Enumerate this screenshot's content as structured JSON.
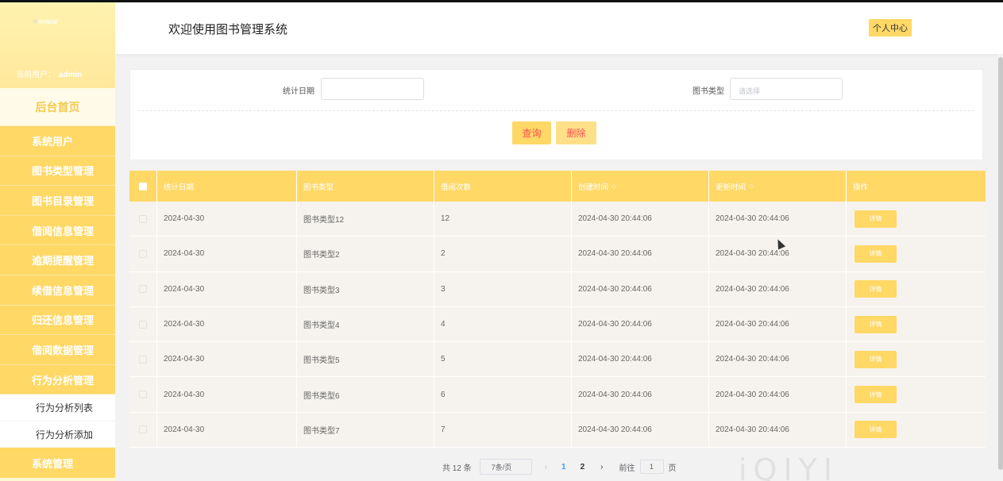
{
  "header": {
    "title": "欢迎使用图书管理系统",
    "profile_label": "个人中心"
  },
  "sidebar": {
    "avatar_alt": "avatar",
    "current_user_label": "当前用户：",
    "current_user": "admin",
    "home": "后台首页",
    "items": [
      {
        "label": "系统用户"
      },
      {
        "label": "图书类型管理"
      },
      {
        "label": "图书目录管理"
      },
      {
        "label": "借阅信息管理"
      },
      {
        "label": "逾期提醒管理"
      },
      {
        "label": "续借信息管理"
      },
      {
        "label": "归还信息管理"
      },
      {
        "label": "借阅数据管理"
      },
      {
        "label": "行为分析管理"
      }
    ],
    "sub_items": [
      {
        "label": "行为分析列表"
      },
      {
        "label": "行为分析添加"
      }
    ],
    "last_item": "系统管理"
  },
  "search": {
    "date_label": "统计日期",
    "date_value": "",
    "type_label": "图书类型",
    "type_placeholder": "请选择",
    "query_button": "查询",
    "delete_button": "删除"
  },
  "table": {
    "columns": [
      "统计日期",
      "图书类型",
      "借阅次数",
      "创建时间",
      "更新时间",
      "操作"
    ],
    "sort_icons": [
      "",
      "",
      "",
      "◇",
      "◇",
      ""
    ],
    "detail_label": "详情",
    "rows": [
      {
        "date": "2024-04-30",
        "type": "图书类型12",
        "count": "12",
        "created": "2024-04-30 20:44:06",
        "updated": "2024-04-30 20:44:06"
      },
      {
        "date": "2024-04-30",
        "type": "图书类型2",
        "count": "2",
        "created": "2024-04-30 20:44:06",
        "updated": "2024-04-30 20:44:06"
      },
      {
        "date": "2024-04-30",
        "type": "图书类型3",
        "count": "3",
        "created": "2024-04-30 20:44:06",
        "updated": "2024-04-30 20:44:06"
      },
      {
        "date": "2024-04-30",
        "type": "图书类型4",
        "count": "4",
        "created": "2024-04-30 20:44:06",
        "updated": "2024-04-30 20:44:06"
      },
      {
        "date": "2024-04-30",
        "type": "图书类型5",
        "count": "5",
        "created": "2024-04-30 20:44:06",
        "updated": "2024-04-30 20:44:06"
      },
      {
        "date": "2024-04-30",
        "type": "图书类型6",
        "count": "6",
        "created": "2024-04-30 20:44:06",
        "updated": "2024-04-30 20:44:06"
      },
      {
        "date": "2024-04-30",
        "type": "图书类型7",
        "count": "7",
        "created": "2024-04-30 20:44:06",
        "updated": "2024-04-30 20:44:06"
      }
    ]
  },
  "pagination": {
    "total": "共 12 条",
    "page_size": "7条/页",
    "prev": "‹",
    "pages": [
      "1",
      "2"
    ],
    "current_page": "1",
    "next": "›",
    "goto_label": "前往",
    "goto_value": "1",
    "goto_unit": "页"
  },
  "watermark": "iqiyi"
}
